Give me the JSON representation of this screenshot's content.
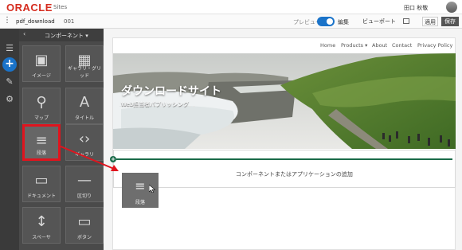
{
  "brand": {
    "logo": "ORACLE",
    "product": "Sites"
  },
  "user": {
    "name": "田口 秋敬"
  },
  "toolbar": {
    "site_name": "pdf_download",
    "page_number": "001",
    "preview_label": "プレビュー",
    "edit_label": "編集",
    "viewport_label": "ビューポート ▾",
    "apply_label": "適用",
    "publish_label": "保存"
  },
  "drawer": {
    "back": "‹",
    "title": "コンポーネント ▾",
    "tiles": [
      {
        "label": "イメージ",
        "icon": "image-icon",
        "glyph": "▣"
      },
      {
        "label": "ギャラリ・グリッド",
        "icon": "gallery-grid-icon",
        "glyph": "▦"
      },
      {
        "label": "マップ",
        "icon": "map-pin-icon",
        "glyph": "⚲"
      },
      {
        "label": "タイトル",
        "icon": "title-icon",
        "glyph": "A"
      },
      {
        "label": "段落",
        "icon": "paragraph-icon",
        "glyph": "≡"
      },
      {
        "label": "ギャラリ",
        "icon": "gallery-icon",
        "glyph": "‹›"
      },
      {
        "label": "ドキュメント",
        "icon": "document-icon",
        "glyph": "▭"
      },
      {
        "label": "区切り",
        "icon": "divider-icon",
        "glyph": "—"
      },
      {
        "label": "スペーサ",
        "icon": "spacer-icon",
        "glyph": "↕"
      },
      {
        "label": "ボタン",
        "icon": "button-icon",
        "glyph": "▭"
      }
    ]
  },
  "site": {
    "nav": [
      "Home",
      "Products ▾",
      "About",
      "Contact",
      "Privacy Policy"
    ],
    "hero_title": "ダウンロードサイト",
    "hero_subtitle": "Web担当者パブリッシング",
    "drop_hint": "コンポーネントまたはアプリケーションの追加"
  },
  "drag": {
    "label": "段落"
  },
  "colors": {
    "accent": "#1a73c9",
    "selection": "#e0141e",
    "insert_line": "#1b6b4a",
    "brand_red": "#d52b1e"
  }
}
